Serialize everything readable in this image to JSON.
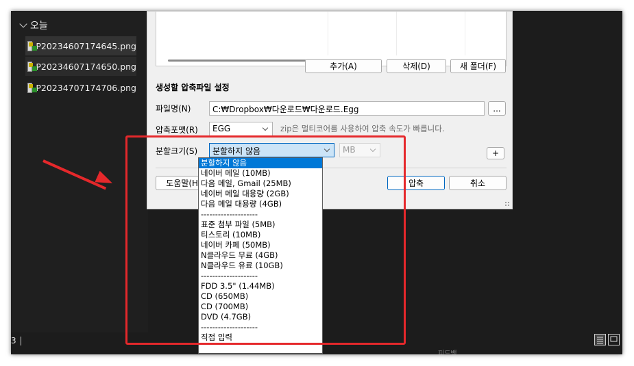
{
  "explorer": {
    "group_label": "오늘",
    "files": [
      "P20234607174645.png",
      "P20234607174650.png",
      "P20234707174706.png"
    ]
  },
  "dialog": {
    "buttons": {
      "add": "추가(A)",
      "delete": "삭제(D)",
      "new_folder": "새 폴더(F)"
    },
    "section_title": "생성할 압축파일 설정",
    "filename_label": "파일명(N)",
    "filename_value": "C:₩Dropbox₩다운로드₩다운로드.Egg",
    "browse_label": "...",
    "format_label": "압축포맷(R)",
    "format_value": "EGG",
    "format_hint": "zip은 멀티코어를 사용하여 압축 속도가 빠릅니다.",
    "split_label": "분할크기(S)",
    "split_value": "분할하지 않음",
    "unit_value": "MB",
    "plus_label": "+",
    "help_label": "도움말(H)",
    "compress_label": "압축",
    "cancel_label": "취소"
  },
  "dropdown_options": [
    "분할하지 않음",
    "네이버 메일 (10MB)",
    "다음 메일, Gmail (25MB)",
    "네이버 메일 대용량 (2GB)",
    "다음 메일 대용량 (4GB)",
    "--------------------",
    "표준 첨부 파일 (5MB)",
    "티스토리 (10MB)",
    "네이버 카페 (50MB)",
    "N클라우드 무료 (4GB)",
    "N클라우드 유료 (10GB)",
    "--------------------",
    "FDD 3.5\" (1.44MB)",
    "CD (650MB)",
    "CD (700MB)",
    "DVD (4.7GB)",
    "--------------------",
    "직접 입력"
  ],
  "dropdown_selected_index": 0,
  "statusbar": {
    "left_text": "3",
    "feedback": "피드백"
  },
  "colors": {
    "highlight": "#e5282b",
    "selection": "#0078d7",
    "accent": "#0067c0"
  }
}
